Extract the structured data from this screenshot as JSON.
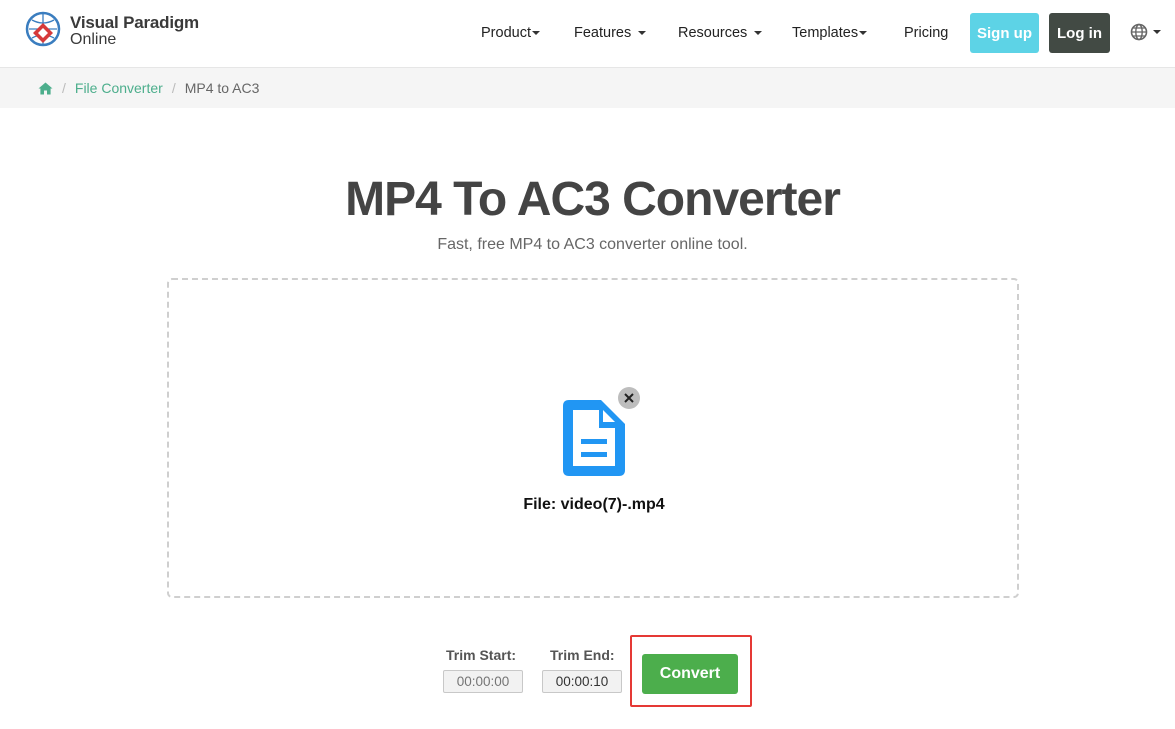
{
  "header": {
    "logo": {
      "line1": "Visual Paradigm",
      "line2": "Online"
    },
    "nav": [
      {
        "label": "Product",
        "has_caret": true
      },
      {
        "label": "Features",
        "has_caret": true
      },
      {
        "label": "Resources",
        "has_caret": true
      },
      {
        "label": "Templates",
        "has_caret": true
      },
      {
        "label": "Pricing",
        "has_caret": false
      }
    ],
    "signup_label": "Sign up",
    "login_label": "Log in",
    "language_icon": "globe-icon"
  },
  "breadcrumb": {
    "home_icon": "home-icon",
    "items": [
      "File Converter",
      "MP4 to AC3"
    ]
  },
  "main": {
    "title": "MP4 To AC3 Converter",
    "subtitle": "Fast, free MP4 to AC3 converter online tool.",
    "file_icon": "file-icon",
    "remove_icon": "close-icon",
    "file_name": "File: video(7)-.mp4",
    "trim_start_label": "Trim Start:",
    "trim_start_placeholder": "00:00:00",
    "trim_end_label": "Trim End:",
    "trim_end_value": "00:00:10",
    "convert_label": "Convert"
  },
  "colors": {
    "accent_green": "#4cae4c",
    "link_green": "#4cae8c",
    "signup": "#5dd3e6",
    "login": "#424a44",
    "file_icon_blue": "#2196f3",
    "highlight_red": "#e53935"
  }
}
